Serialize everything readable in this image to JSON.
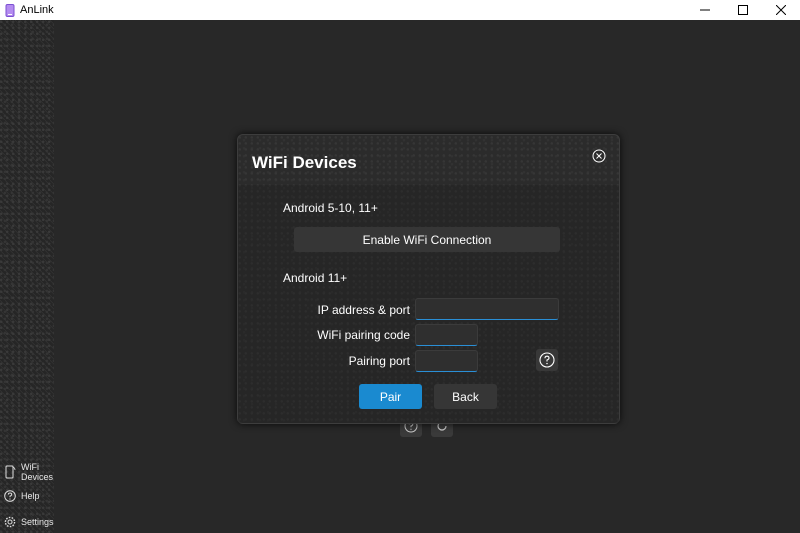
{
  "window": {
    "title": "AnLink",
    "controls": [
      "minimize-icon",
      "maximize-icon",
      "close-icon"
    ]
  },
  "sidebar": {
    "items": [
      {
        "label": "WiFi\nDevices",
        "label_line1": "WiFi",
        "label_line2": "Devices",
        "icon": "phone-icon"
      },
      {
        "label": "Help",
        "icon": "question-icon"
      },
      {
        "label": "Settings",
        "icon": "gear-icon"
      }
    ]
  },
  "dialog": {
    "title": "WiFi Devices",
    "section1": "Android 5-10, 11+",
    "enable_button": "Enable WiFi Connection",
    "section2": "Android 11+",
    "fields": {
      "ip_label": "IP address & port",
      "ip_value": "",
      "code_label": "WiFi pairing code",
      "code_value": "",
      "port_label": "Pairing port",
      "port_value": ""
    },
    "pair_button": "Pair",
    "back_button": "Back"
  },
  "colors": {
    "accent": "#1a8ad0",
    "background": "#262626",
    "input_underline": "#2a8fd6"
  }
}
